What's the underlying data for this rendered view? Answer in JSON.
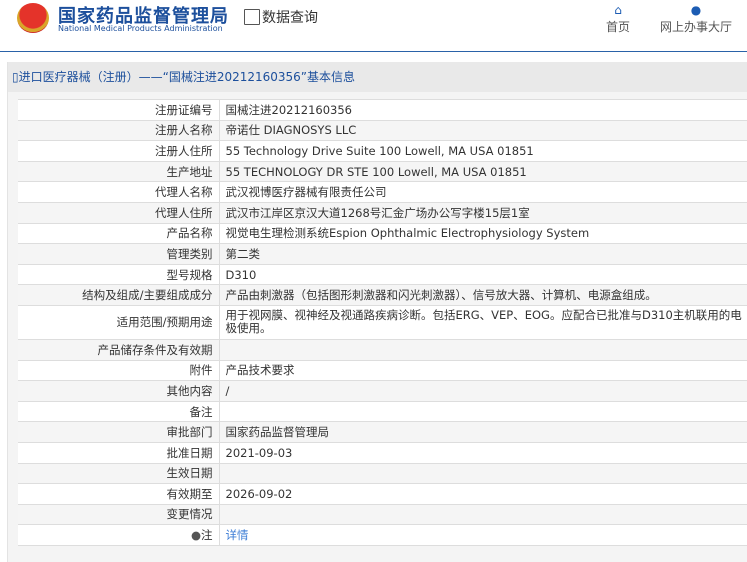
{
  "header": {
    "logo_cn": "国家药品监督管理局",
    "logo_en": "National Medical Products Administration",
    "query": "数据查询",
    "nav": [
      {
        "label": "首页",
        "icon": "home-icon"
      },
      {
        "label": "网上办事大厅",
        "icon": "user-icon"
      }
    ]
  },
  "breadcrumb": "进口医疗器械（注册）——“国械注进20212160356”基本信息",
  "rows": [
    {
      "label": "注册证编号",
      "value": "国械注进20212160356"
    },
    {
      "label": "注册人名称",
      "value": "帝诺仕 DIAGNOSYS LLC"
    },
    {
      "label": "注册人住所",
      "value": "55 Technology Drive Suite 100 Lowell, MA USA 01851"
    },
    {
      "label": "生产地址",
      "value": "55 TECHNOLOGY DR STE 100 Lowell, MA USA 01851"
    },
    {
      "label": "代理人名称",
      "value": "武汉视博医疗器械有限责任公司"
    },
    {
      "label": "代理人住所",
      "value": "武汉市江岸区京汉大道1268号汇金广场办公写字楼15层1室"
    },
    {
      "label": "产品名称",
      "value": "视觉电生理检测系统Espion Ophthalmic Electrophysiology System"
    },
    {
      "label": "管理类别",
      "value": "第二类"
    },
    {
      "label": "型号规格",
      "value": "D310"
    },
    {
      "label": "结构及组成/主要组成成分",
      "value": "产品由刺激器（包括图形刺激器和闪光刺激器）、信号放大器、计算机、电源盒组成。"
    },
    {
      "label": "适用范围/预期用途",
      "value": "用于视网膜、视神经及视通路疾病诊断。包括ERG、VEP、EOG。应配合已批准与D310主机联用的电极使用。"
    },
    {
      "label": "产品储存条件及有效期",
      "value": ""
    },
    {
      "label": "附件",
      "value": "产品技术要求"
    },
    {
      "label": "其他内容",
      "value": "/"
    },
    {
      "label": "备注",
      "value": ""
    },
    {
      "label": "审批部门",
      "value": "国家药品监督管理局"
    },
    {
      "label": "批准日期",
      "value": "2021-09-03"
    },
    {
      "label": "生效日期",
      "value": ""
    },
    {
      "label": "有效期至",
      "value": "2026-09-02"
    },
    {
      "label": "变更情况",
      "value": ""
    }
  ],
  "note": {
    "label": "注",
    "link": "详情"
  }
}
